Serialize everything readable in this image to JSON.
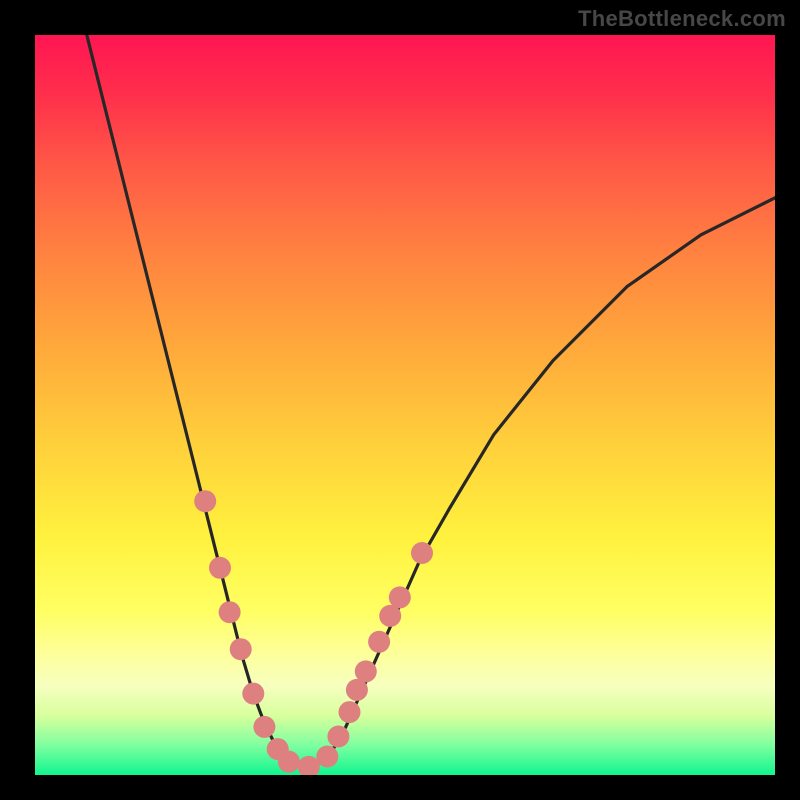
{
  "watermark": "TheBottleneck.com",
  "colors": {
    "curve": "#262726",
    "marker_fill": "#de8080",
    "background_black": "#000000"
  },
  "chart_data": {
    "type": "line",
    "title": "",
    "xlabel": "",
    "ylabel": "",
    "xlim": [
      0,
      100
    ],
    "ylim": [
      0,
      100
    ],
    "annotations": [
      "TheBottleneck.com"
    ],
    "series": [
      {
        "name": "curve",
        "x": [
          7,
          9,
          11,
          13,
          15,
          17,
          19,
          21,
          23,
          25,
          26.5,
          28,
          29.5,
          31,
          32.5,
          34,
          36,
          38,
          40,
          42,
          44,
          48,
          52,
          56,
          62,
          70,
          80,
          90,
          100
        ],
        "y": [
          100,
          92,
          84,
          76,
          68,
          60,
          52,
          44,
          36,
          28,
          22,
          16,
          11,
          7,
          4,
          2,
          1,
          1.3,
          3,
          6.5,
          11,
          20,
          29,
          36,
          46,
          56,
          66,
          73,
          78
        ]
      }
    ],
    "markers": [
      {
        "name": "left-marker-1",
        "x": 23.0,
        "y": 37
      },
      {
        "name": "left-marker-2",
        "x": 25.0,
        "y": 28
      },
      {
        "name": "left-marker-3",
        "x": 26.3,
        "y": 22
      },
      {
        "name": "left-marker-4",
        "x": 27.8,
        "y": 17
      },
      {
        "name": "left-marker-5",
        "x": 29.5,
        "y": 11
      },
      {
        "name": "left-marker-6",
        "x": 31.0,
        "y": 6.5
      },
      {
        "name": "left-marker-7",
        "x": 32.8,
        "y": 3.5
      },
      {
        "name": "bottom-marker-1",
        "x": 34.3,
        "y": 1.8
      },
      {
        "name": "bottom-marker-2",
        "x": 37.0,
        "y": 1.1
      },
      {
        "name": "right-marker-1",
        "x": 39.5,
        "y": 2.5
      },
      {
        "name": "right-marker-2",
        "x": 41.0,
        "y": 5.2
      },
      {
        "name": "right-marker-3",
        "x": 42.5,
        "y": 8.5
      },
      {
        "name": "right-marker-4",
        "x": 43.5,
        "y": 11.5
      },
      {
        "name": "right-marker-5",
        "x": 44.7,
        "y": 14
      },
      {
        "name": "right-marker-6",
        "x": 46.5,
        "y": 18
      },
      {
        "name": "right-marker-7",
        "x": 48.0,
        "y": 21.5
      },
      {
        "name": "right-marker-8",
        "x": 49.3,
        "y": 24
      },
      {
        "name": "right-marker-9",
        "x": 52.3,
        "y": 30
      }
    ]
  }
}
